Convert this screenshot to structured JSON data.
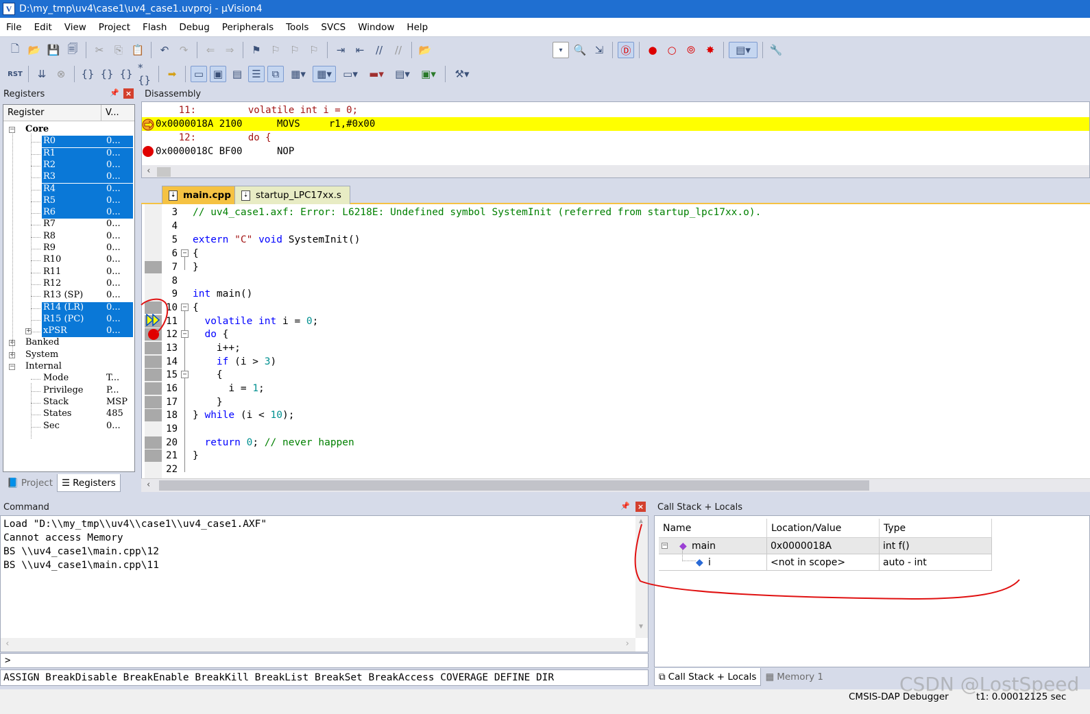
{
  "window": {
    "title": "D:\\my_tmp\\uv4\\case1\\uv4_case1.uvproj - µVision4"
  },
  "menu": [
    "File",
    "Edit",
    "View",
    "Project",
    "Flash",
    "Debug",
    "Peripherals",
    "Tools",
    "SVCS",
    "Window",
    "Help"
  ],
  "registers": {
    "header": "Registers",
    "col_register": "Register",
    "col_value": "V...",
    "groups": {
      "core": "Core",
      "banked": "Banked",
      "system": "System",
      "internal": "Internal"
    },
    "core": [
      {
        "name": "R0",
        "value": "0..."
      },
      {
        "name": "R1",
        "value": "0..."
      },
      {
        "name": "R2",
        "value": "0..."
      },
      {
        "name": "R3",
        "value": "0..."
      },
      {
        "name": "R4",
        "value": "0..."
      },
      {
        "name": "R5",
        "value": "0..."
      },
      {
        "name": "R6",
        "value": "0..."
      },
      {
        "name": "R7",
        "value": "0..."
      },
      {
        "name": "R8",
        "value": "0..."
      },
      {
        "name": "R9",
        "value": "0..."
      },
      {
        "name": "R10",
        "value": "0..."
      },
      {
        "name": "R11",
        "value": "0..."
      },
      {
        "name": "R12",
        "value": "0..."
      },
      {
        "name": "R13 (SP)",
        "value": "0..."
      },
      {
        "name": "R14 (LR)",
        "value": "0..."
      },
      {
        "name": "R15 (PC)",
        "value": "0..."
      },
      {
        "name": "xPSR",
        "value": "0..."
      }
    ],
    "internal": [
      {
        "name": "Mode",
        "value": "T..."
      },
      {
        "name": "Privilege",
        "value": "P..."
      },
      {
        "name": "Stack",
        "value": "MSP"
      },
      {
        "name": "States",
        "value": "485"
      },
      {
        "name": "Sec",
        "value": "0..."
      }
    ],
    "tabs": {
      "project": "Project",
      "registers": "Registers"
    }
  },
  "disassembly": {
    "header": "Disassembly",
    "lines": [
      {
        "text": "    11:         volatile int i = 0;"
      },
      {
        "text": "0x0000018A 2100      MOVS     r1,#0x00"
      },
      {
        "text": "    12:         do {"
      },
      {
        "text": "0x0000018C BF00      NOP"
      }
    ]
  },
  "editor": {
    "tabs": [
      "main.cpp",
      "startup_LPC17xx.s"
    ],
    "line_numbers": [
      "3",
      "4",
      "5",
      "6",
      "7",
      "8",
      "9",
      "10",
      "11",
      "12",
      "13",
      "14",
      "15",
      "16",
      "17",
      "18",
      "19",
      "20",
      "21",
      "22"
    ],
    "comment_line": "// uv4_case1.axf: Error: L6218E: Undefined symbol SystemInit (referred from startup_lpc17xx.o)."
  },
  "command": {
    "header": "Command",
    "lines": [
      "Load \"D:\\\\my_tmp\\\\uv4\\\\case1\\\\uv4_case1.AXF\"",
      "Cannot access Memory",
      "BS \\\\uv4_case1\\main.cpp\\12",
      "BS \\\\uv4_case1\\main.cpp\\11"
    ],
    "prompt": ">",
    "help": "ASSIGN BreakDisable BreakEnable BreakKill BreakList BreakSet BreakAccess COVERAGE DEFINE DIR"
  },
  "locals": {
    "header": "Call Stack + Locals",
    "columns": [
      "Name",
      "Location/Value",
      "Type"
    ],
    "rows": [
      {
        "name": "main",
        "value": "0x0000018A",
        "type": "int f()"
      },
      {
        "name": "i",
        "value": "<not in scope>",
        "type": "auto - int"
      }
    ],
    "tabs": {
      "callstack": "Call Stack + Locals",
      "memory": "Memory 1"
    }
  },
  "status": {
    "debugger": "CMSIS-DAP Debugger",
    "time": "t1: 0.00012125 sec"
  },
  "watermark": "CSDN @LostSpeed"
}
